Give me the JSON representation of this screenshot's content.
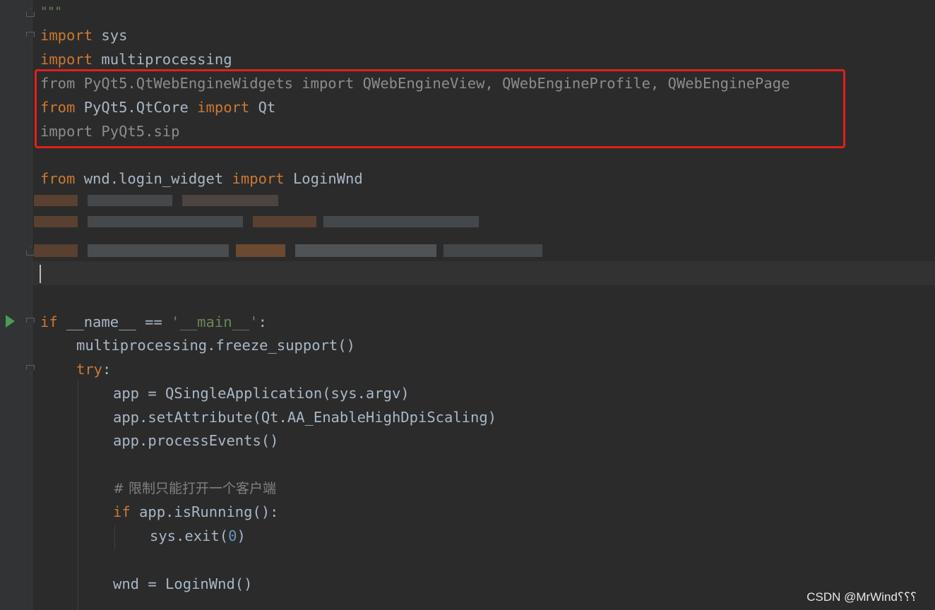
{
  "code": {
    "line_docstring_end": "\"\"\"",
    "line_import_sys": {
      "kw": "import",
      "rest": " sys"
    },
    "line_import_mp": {
      "kw": "import",
      "rest": " multiprocessing"
    },
    "line_from_webengine": "from PyQt5.QtWebEngineWidgets import QWebEngineView, QWebEngineProfile, QWebEnginePage",
    "line_from_qtcore": {
      "kw1": "from",
      "mid": " PyQt5.QtCore ",
      "kw2": "import",
      "rest": " Qt"
    },
    "line_import_sip": "import PyQt5.sip",
    "line_from_wnd": {
      "kw1": "from",
      "mid": " wnd.login_widget ",
      "kw2": "import",
      "rest": " LoginWnd"
    },
    "line_if_main": {
      "kw": "if",
      "mid": " __name__ == ",
      "str": "'__main__'",
      "rest": ":"
    },
    "line_freeze": "multiprocessing.freeze_support()",
    "line_try": {
      "kw": "try",
      "rest": ":"
    },
    "line_app": "app = QSingleApplication(sys.argv)",
    "line_set_attr": "app.setAttribute(Qt.AA_EnableHighDpiScaling)",
    "line_process": "app.processEvents()",
    "line_comment": "# 限制只能打开一个客户端",
    "line_if_running": {
      "kw": "if",
      "rest": " app.isRunning():"
    },
    "line_sys_exit": {
      "pre": "sys.exit(",
      "num": "0",
      "post": ")"
    },
    "line_wnd": "wnd = LoginWnd()"
  },
  "colors": {
    "keyword": "#cc7832",
    "text": "#a9b7c6",
    "string": "#6a8759",
    "number": "#6897bb",
    "comment": "#808080",
    "unused_import": "#8c8c8c",
    "highlight_box": "#e0201b",
    "run_icon": "#499c54",
    "background": "#2b2b2b"
  },
  "icons": {
    "run": "run-gutter-icon",
    "fold": "fold-marker-icon"
  },
  "watermark": "CSDN @MrWind⸮⸮⸮"
}
